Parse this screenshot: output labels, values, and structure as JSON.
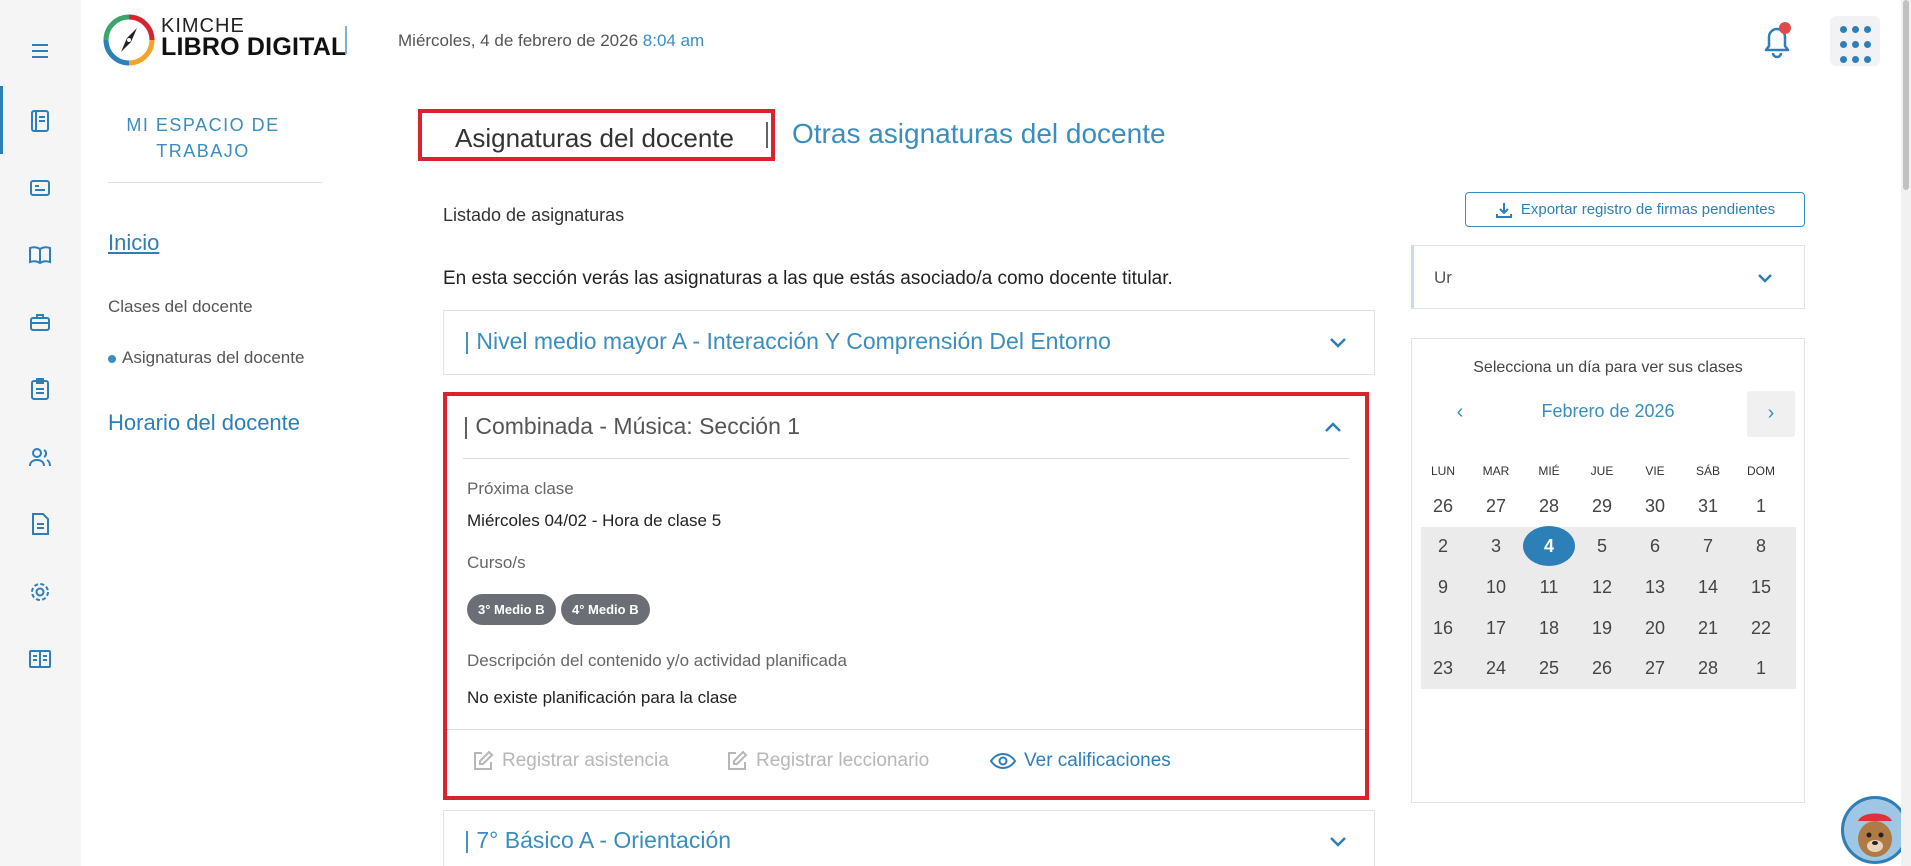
{
  "header": {
    "brand_top": "KIMCHE",
    "brand_bottom": "LIBRO DIGITAL",
    "date": "Miércoles, 4 de febrero de 2026",
    "time": "8:04 am"
  },
  "sidebar_nav": {
    "workspace_title": "MI ESPACIO DE TRABAJO",
    "inicio": "Inicio",
    "clases": "Clases del docente",
    "asignaturas": "Asignaturas del docente",
    "horario": "Horario del docente"
  },
  "tabs": {
    "active": "Asignaturas del docente",
    "other": "Otras asignaturas del docente"
  },
  "main": {
    "list_title": "Listado de asignaturas",
    "intro": "En esta sección verás las asignaturas a las que estás asociado/a como docente titular.",
    "accordions": [
      {
        "title": "| Nivel medio mayor A - Interacción Y Comprensión Del Entorno"
      },
      {
        "title": "| Combinada - Música: Sección 1",
        "next_class_label": "Próxima clase",
        "next_class_value": "Miércoles 04/02 - Hora de clase 5",
        "courses_label": "Curso/s",
        "courses": [
          "3° Medio B",
          "4° Medio B"
        ],
        "desc_label": "Descripción del contenido y/o actividad planificada",
        "desc_value": "No existe planificación para la clase",
        "actions": {
          "attendance": "Registrar asistencia",
          "lectionary": "Registrar leccionario",
          "grades": "Ver calificaciones"
        }
      },
      {
        "title": "| 7° Básico A - Orientación"
      }
    ]
  },
  "right": {
    "export_button": "Exportar registro de firmas pendientes",
    "select_value": "Ur",
    "calendar": {
      "hint": "Selecciona un día para ver sus clases",
      "month": "Febrero de 2026",
      "prev": "‹",
      "next": "›",
      "weekdays": [
        "LUN",
        "MAR",
        "MIÉ",
        "JUE",
        "VIE",
        "SÁB",
        "DOM"
      ],
      "weeks": [
        [
          "26",
          "27",
          "28",
          "29",
          "30",
          "31",
          "1"
        ],
        [
          "2",
          "3",
          "4",
          "5",
          "6",
          "7",
          "8"
        ],
        [
          "9",
          "10",
          "11",
          "12",
          "13",
          "14",
          "15"
        ],
        [
          "16",
          "17",
          "18",
          "19",
          "20",
          "21",
          "22"
        ],
        [
          "23",
          "24",
          "25",
          "26",
          "27",
          "28",
          "1"
        ]
      ],
      "selected": "4"
    }
  },
  "colors": {
    "accent": "#2d7fb8",
    "highlight_red": "#d9232e"
  }
}
